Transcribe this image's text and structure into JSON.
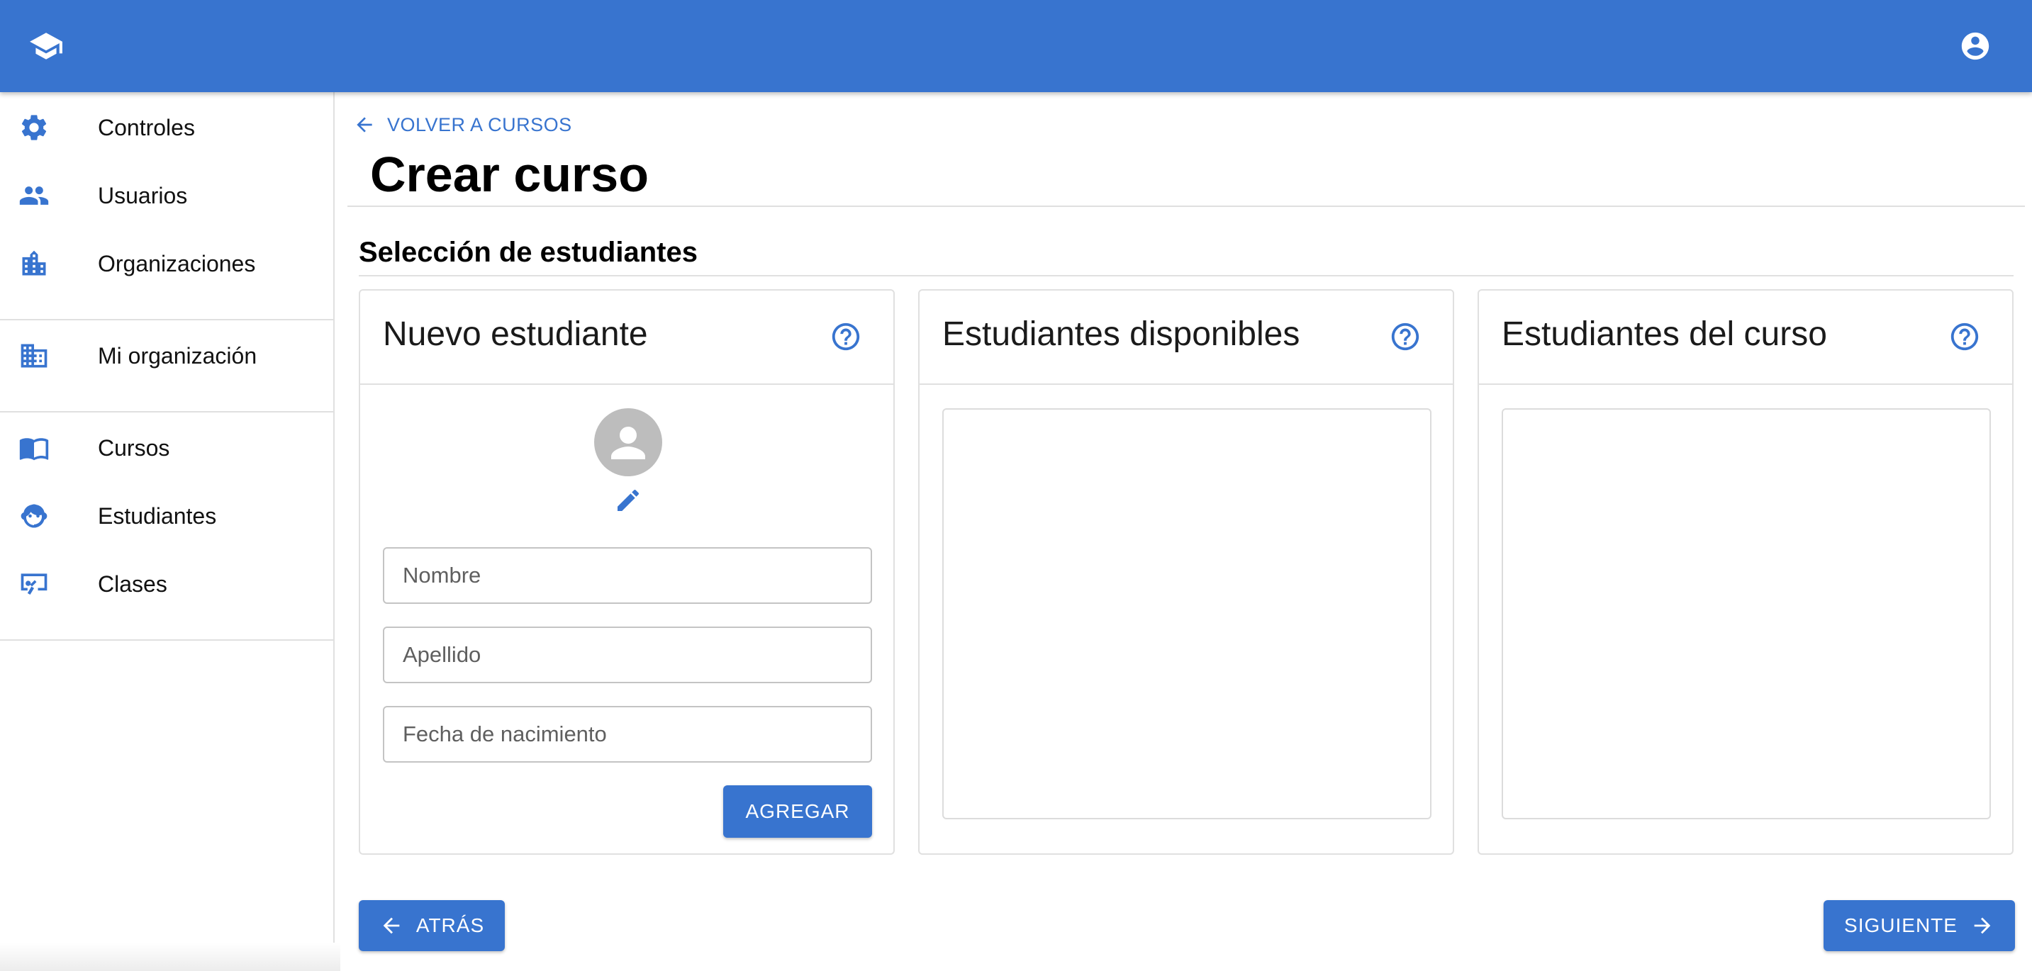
{
  "colors": {
    "primary": "#3874cf",
    "icon": "#3874cf"
  },
  "header": {
    "logo_icon": "graduation-cap-icon",
    "account_icon": "account-circle-icon"
  },
  "sidebar": {
    "groups": [
      [
        {
          "label": "Controles",
          "icon": "gear-icon"
        },
        {
          "label": "Usuarios",
          "icon": "people-icon"
        },
        {
          "label": "Organizaciones",
          "icon": "building-icon"
        }
      ],
      [
        {
          "label": "Mi organización",
          "icon": "business-icon"
        }
      ],
      [
        {
          "label": "Cursos",
          "icon": "book-icon"
        },
        {
          "label": "Estudiantes",
          "icon": "child-face-icon"
        },
        {
          "label": "Clases",
          "icon": "presentation-icon"
        }
      ]
    ]
  },
  "main": {
    "back_link": "VOLVER A CURSOS",
    "title": "Crear curso",
    "section_title": "Selección de estudiantes",
    "cards": {
      "new_student": {
        "title": "Nuevo estudiante",
        "fields": {
          "first_name": "Nombre",
          "last_name": "Apellido",
          "birth_date": "Fecha de nacimiento"
        },
        "add_button": "AGREGAR"
      },
      "available": {
        "title": "Estudiantes disponibles"
      },
      "enrolled": {
        "title": "Estudiantes del curso"
      }
    },
    "back_button": "ATRÁS",
    "next_button": "SIGUIENTE"
  }
}
